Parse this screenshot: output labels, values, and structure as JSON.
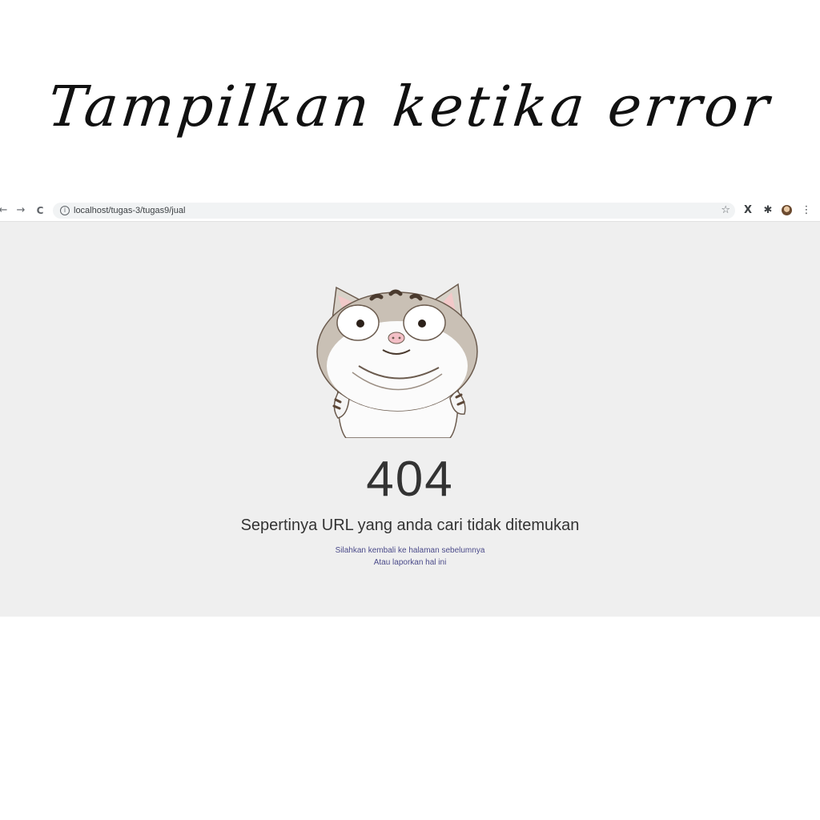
{
  "caption": "Tampilkan ketika error",
  "browser": {
    "nav": {
      "back": "←",
      "forward": "→",
      "reload": "C"
    },
    "url": "localhost/tugas-3/tugas9/jual",
    "extensions": {
      "x": "X",
      "puzzle": "✱",
      "menu": "⋮"
    }
  },
  "page": {
    "error_code": "404",
    "message": "Sepertinya URL yang anda cari tidak ditemukan",
    "back_link": "Silahkan kembali ke halaman sebelumnya",
    "report_link": "Atau laporkan hal ini"
  }
}
